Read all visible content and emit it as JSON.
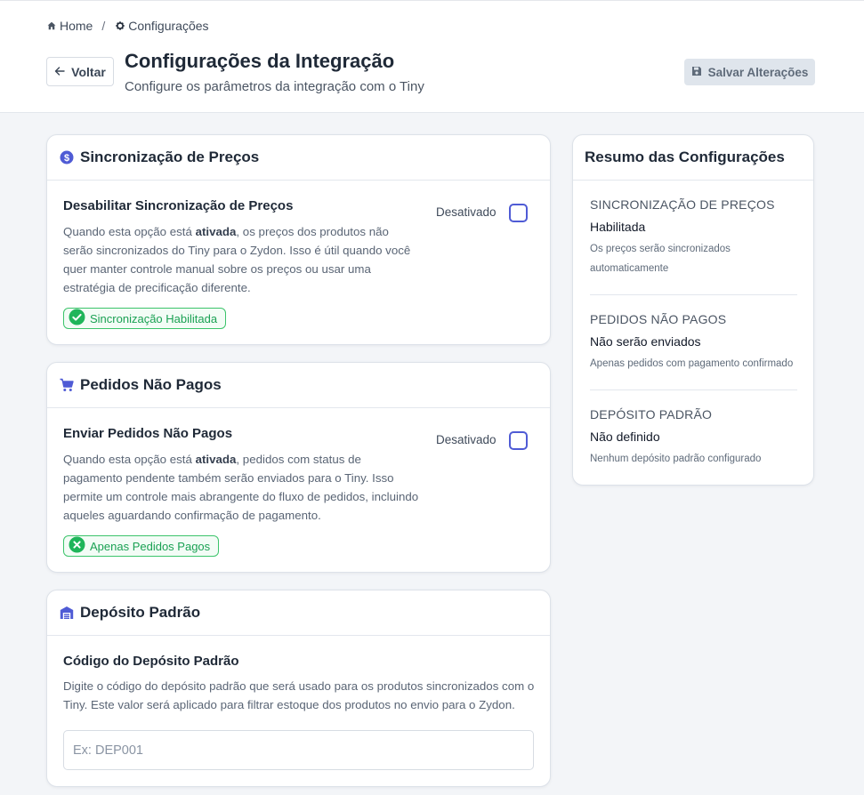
{
  "breadcrumb": {
    "home": "Home",
    "separator": "/",
    "current": "Configurações"
  },
  "header": {
    "back_label": "Voltar",
    "title": "Configurações da Integração",
    "subtitle": "Configure os parâmetros da integração com o Tiny",
    "save_label": "Salvar Alterações"
  },
  "price_sync": {
    "title": "Sincronização de Preços",
    "setting_title": "Desabilitar Sincronização de Preços",
    "desc_before": "Quando esta opção está ",
    "desc_bold": "ativada",
    "desc_after": ", os preços dos produtos não serão sincronizados do Tiny para o Zydon. Isso é útil quando você quer manter controle manual sobre os preços ou usar uma estratégia de precificação diferente.",
    "toggle_label": "Desativado",
    "badge": "Sincronização Habilitada",
    "checked": false
  },
  "unpaid_orders": {
    "title": "Pedidos Não Pagos",
    "setting_title": "Enviar Pedidos Não Pagos",
    "desc_before": "Quando esta opção está ",
    "desc_bold": "ativada",
    "desc_after": ", pedidos com status de pagamento pendente também serão enviados para o Tiny. Isso permite um controle mais abrangente do fluxo de pedidos, incluindo aqueles aguardando confirmação de pagamento.",
    "toggle_label": "Desativado",
    "badge": "Apenas Pedidos Pagos",
    "checked": false
  },
  "deposit": {
    "title": "Depósito Padrão",
    "setting_title": "Código do Depósito Padrão",
    "description": "Digite o código do depósito padrão que será usado para os produtos sincronizados com o Tiny. Este valor será aplicado para filtrar estoque dos produtos no envio para o Zydon.",
    "input_value": "",
    "input_placeholder": "Ex: DEP001"
  },
  "summary": {
    "title": "Resumo das Configurações",
    "sections": [
      {
        "heading": "SINCRONIZAÇÃO DE PREÇOS",
        "value": "Habilitada",
        "note": "Os preços serão sincronizados automaticamente"
      },
      {
        "heading": "PEDIDOS NÃO PAGOS",
        "value": "Não serão enviados",
        "note": "Apenas pedidos com pagamento confirmado"
      },
      {
        "heading": "DEPÓSITO PADRÃO",
        "value": "Não definido",
        "note": "Nenhum depósito padrão configurado"
      }
    ]
  },
  "icons": {
    "breadcrumb_home": "home-icon",
    "breadcrumb_settings": "gear-icon",
    "back": "arrow-left-icon",
    "save": "floppy-disk-icon",
    "price_sync": "dollar-circle-icon",
    "unpaid_orders": "shopping-cart-icon",
    "deposit": "warehouse-icon",
    "badge_enabled": "check-circle-icon",
    "badge_disabled": "x-circle-icon"
  },
  "colors": {
    "accent": "#4f5bd5",
    "success": "#1aa153",
    "success_border": "#3cc46b",
    "page_bg": "#f3f5f8",
    "save_button_bg": "#dfe5ec"
  }
}
